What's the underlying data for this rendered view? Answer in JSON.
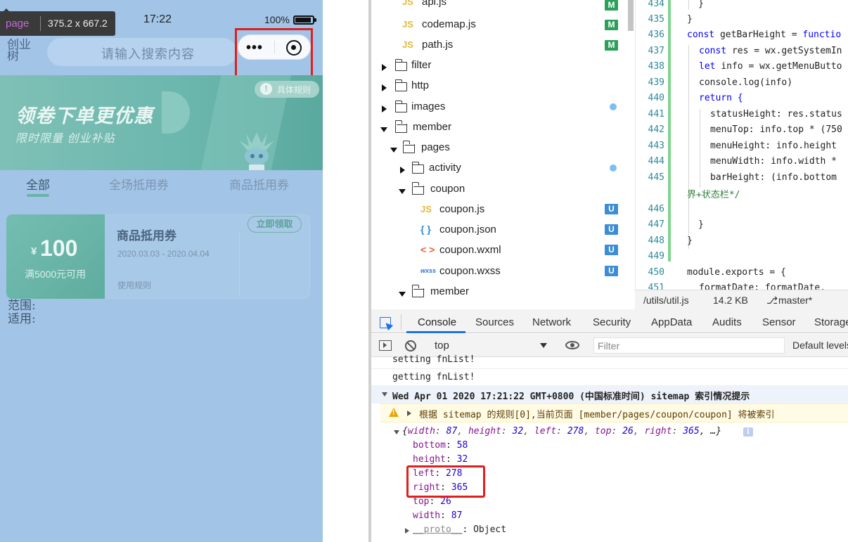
{
  "simulator": {
    "status_time": "17:22",
    "battery_pct": "100%",
    "tooltip_page": "page",
    "tooltip_dims": "375.2 x 667.2",
    "brand": "创业树",
    "search_placeholder": "请输入搜索内容",
    "capsule_dots": "•••",
    "banner": {
      "title": "领卷下单更优惠",
      "subtitle": "限时限量  创业补贴",
      "rules_icon": "!",
      "rules_text": "具体规则"
    },
    "tabs": [
      "全部",
      "全场抵用券",
      "商品抵用券"
    ],
    "coupon": {
      "currency": "¥",
      "amount": "100",
      "condition": "满5000元可用",
      "title": "商品抵用券",
      "date": "2020.03.03 - 2020.04.04",
      "rules": "使用规则",
      "button": "立即领取"
    },
    "range_label": "范围:",
    "scope_label": "适用:"
  },
  "file_tree": [
    {
      "name": "api.js",
      "kind": "js",
      "badge": "M"
    },
    {
      "name": "codemap.js",
      "kind": "js",
      "badge": "M"
    },
    {
      "name": "path.js",
      "kind": "js",
      "badge": "M"
    },
    {
      "name": "filter",
      "kind": "folder"
    },
    {
      "name": "http",
      "kind": "folder"
    },
    {
      "name": "images",
      "kind": "folder"
    },
    {
      "name": "member",
      "kind": "folder-open"
    },
    {
      "name": "pages",
      "kind": "folder-open"
    },
    {
      "name": "activity",
      "kind": "folder"
    },
    {
      "name": "coupon",
      "kind": "folder-open"
    },
    {
      "name": "coupon.js",
      "kind": "js",
      "badge": "U"
    },
    {
      "name": "coupon.json",
      "kind": "json",
      "badge": "U"
    },
    {
      "name": "coupon.wxml",
      "kind": "wxml",
      "badge": "U"
    },
    {
      "name": "coupon.wxss",
      "kind": "wxss",
      "badge": "U"
    },
    {
      "name": "member",
      "kind": "folder-open"
    }
  ],
  "file_icons": {
    "js": "JS",
    "json": "{ }",
    "wxml": "< >",
    "wxss": "wxss"
  },
  "editor": {
    "line_numbers": [
      "434",
      "435",
      "436",
      "437",
      "438",
      "439",
      "440",
      "441",
      "442",
      "443",
      "444",
      "445",
      "446",
      "447",
      "448",
      "449",
      "450",
      "451"
    ],
    "lines": [
      "}",
      "}",
      "getBarHeight = ",
      "res = wx.getSystemIn",
      "info = wx.getMenuButto",
      "console.log(info)",
      "return {",
      "statusHeight: res.status",
      "menuTop: info.top * (750",
      "menuHeight: info.height",
      "menuWidth: info.width *",
      "barHeight: (info.bottom",
      "界+状态栏*/",
      "}",
      "}",
      "module.exports = {",
      "formatDate: formatDate,"
    ],
    "kw_const": "const",
    "kw_let": "let",
    "kw_function": "functio",
    "kw_return": "return",
    "status_path": "/utils/util.js",
    "status_size": "14.2 KB",
    "status_branch": "master*"
  },
  "devtools": {
    "tabs": [
      "Console",
      "Sources",
      "Network",
      "Security",
      "AppData",
      "Audits",
      "Sensor",
      "Storage"
    ],
    "context": "top",
    "filter_placeholder": "Filter",
    "levels": "Default levels",
    "console_lines": {
      "l0": "setting fnList!",
      "l1": "getting fnList!",
      "group": "Wed Apr 01 2020 17:21:22 GMT+0800 (中国标准时间) sitemap 索引情况提示",
      "warn": "根据 sitemap 的规则[0],当前页面 [member/pages/coupon/coupon] 将被索引",
      "obj_open": "{",
      "obj_preview": [
        {
          "k": "width",
          "v": "87"
        },
        {
          "k": "height",
          "v": "32"
        },
        {
          "k": "left",
          "v": "278"
        },
        {
          "k": "top",
          "v": "26"
        },
        {
          "k": "right",
          "v": "365"
        }
      ],
      "obj_tail": ", …}",
      "info_icon": "i",
      "props": [
        {
          "k": "bottom",
          "v": "58"
        },
        {
          "k": "height",
          "v": "32"
        },
        {
          "k": "left",
          "v": "278"
        },
        {
          "k": "right",
          "v": "365"
        },
        {
          "k": "top",
          "v": "26"
        },
        {
          "k": "width",
          "v": "87"
        }
      ],
      "proto": "__proto__",
      "proto_val": ": Object"
    }
  },
  "colors": {
    "highlight": "#e0201c",
    "accent": "#1a73e8",
    "badge_modified": "#2ca05a",
    "badge_untracked": "#3c8dd6",
    "sim_bg": "#a2c4e6",
    "coupon_teal": "#6bb3a7"
  }
}
